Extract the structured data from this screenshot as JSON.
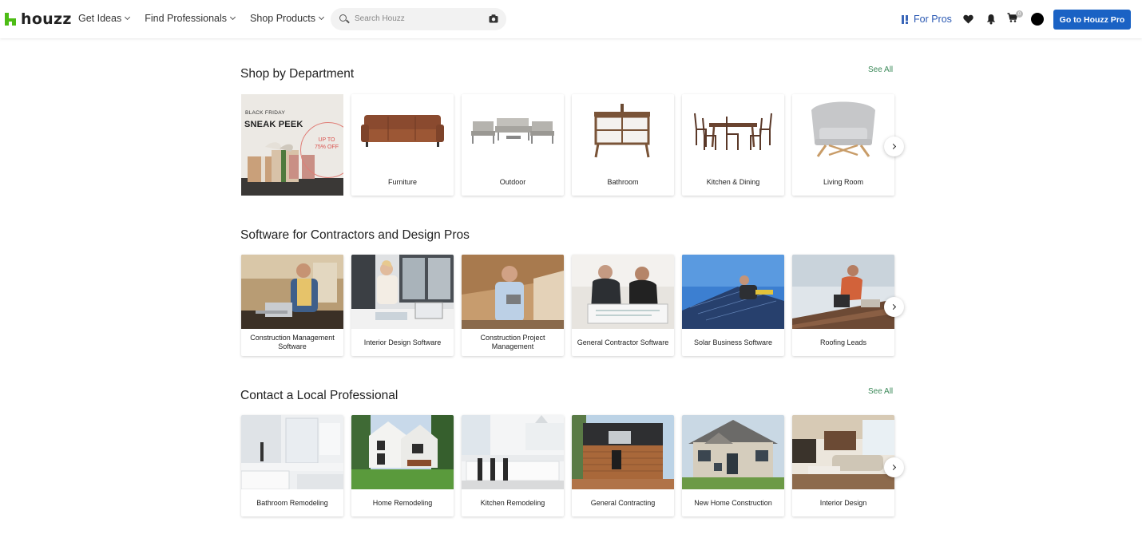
{
  "header": {
    "logo_text": "houzz",
    "nav": [
      {
        "label": "Get Ideas"
      },
      {
        "label": "Find Professionals"
      },
      {
        "label": "Shop Products"
      }
    ],
    "search": {
      "placeholder": "Search Houzz",
      "value": ""
    },
    "for_pros_label": "For Pros",
    "cart_count": "0",
    "cta_label": "Go to Houzz Pro",
    "brand_green": "#4dbc15",
    "cta_blue": "#1a62c4"
  },
  "shop_department": {
    "title": "Shop by Department",
    "see_all": "See All",
    "promo": {
      "line1": "BLACK FRIDAY",
      "line2": "SNEAK PEEK",
      "line3": "UP TO",
      "line4": "75% OFF"
    },
    "cards": [
      {
        "label": "Furniture",
        "icon": "sofa-image"
      },
      {
        "label": "Outdoor",
        "icon": "patio-set-image"
      },
      {
        "label": "Bathroom",
        "icon": "vanity-image"
      },
      {
        "label": "Kitchen & Dining",
        "icon": "dining-set-image"
      },
      {
        "label": "Living Room",
        "icon": "armchair-image"
      }
    ]
  },
  "software": {
    "title": "Software for Contractors and Design Pros",
    "cards": [
      {
        "label": "Construction Management Software"
      },
      {
        "label": "Interior Design Software"
      },
      {
        "label": "Construction Project Management"
      },
      {
        "label": "General Contractor Software"
      },
      {
        "label": "Solar Business Software"
      },
      {
        "label": "Roofing Leads"
      }
    ]
  },
  "local_pro": {
    "title": "Contact a Local Professional",
    "see_all": "See All",
    "cards": [
      {
        "label": "Bathroom Remodeling"
      },
      {
        "label": "Home Remodeling"
      },
      {
        "label": "Kitchen Remodeling"
      },
      {
        "label": "General Contracting"
      },
      {
        "label": "New Home Construction"
      },
      {
        "label": "Interior Design"
      }
    ]
  }
}
